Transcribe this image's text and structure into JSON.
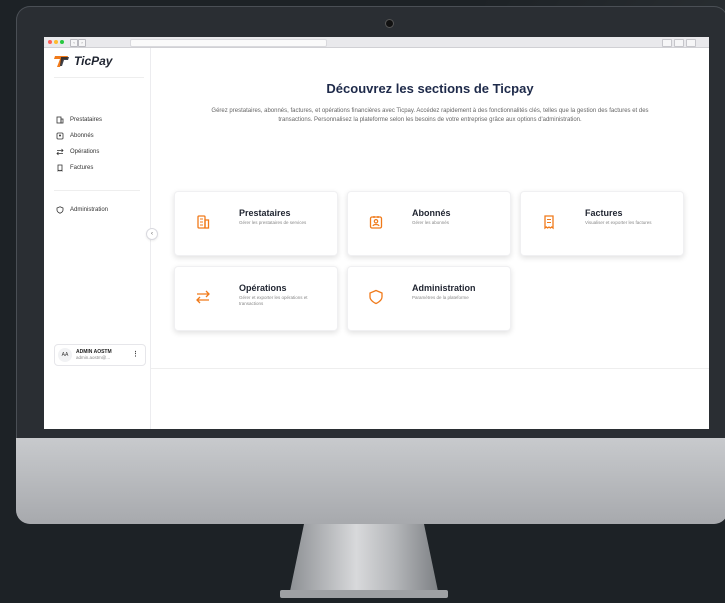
{
  "brand": {
    "name": "TicPay",
    "accent": "#f07a1a"
  },
  "sidebar": {
    "items": [
      {
        "label": "Prestataires",
        "icon": "building-icon"
      },
      {
        "label": "Abonnés",
        "icon": "id-badge-icon"
      },
      {
        "label": "Opérations",
        "icon": "arrows-exchange-icon"
      },
      {
        "label": "Factures",
        "icon": "receipt-icon"
      }
    ],
    "admin_item": {
      "label": "Administration",
      "icon": "shield-icon"
    },
    "collapse_label": "‹"
  },
  "user": {
    "initials": "AA",
    "name": "ADMIN AOSTM",
    "email": "admin.aostm@...",
    "menu_label": "⋮"
  },
  "main": {
    "title": "Découvrez les sections de Ticpay",
    "description": "Gérez prestataires, abonnés, factures, et opérations financières avec Ticpay. Accédez rapidement à des fonctionnalités clés, telles que la gestion des factures et des transactions. Personnalisez la plateforme selon les besoins de votre entreprise grâce aux options d'administration."
  },
  "cards": [
    {
      "title": "Prestataires",
      "desc": "Gérer les prestataires de services",
      "icon": "building-icon"
    },
    {
      "title": "Abonnés",
      "desc": "Gérer les abonnés",
      "icon": "id-badge-icon"
    },
    {
      "title": "Factures",
      "desc": "Visualiser et exporter les factures",
      "icon": "receipt-icon"
    },
    {
      "title": "Opérations",
      "desc": "Gérer et exporter les opérations et transactions",
      "icon": "arrows-exchange-icon"
    },
    {
      "title": "Administration",
      "desc": "Paramètres de la plateforme",
      "icon": "shield-icon"
    }
  ]
}
